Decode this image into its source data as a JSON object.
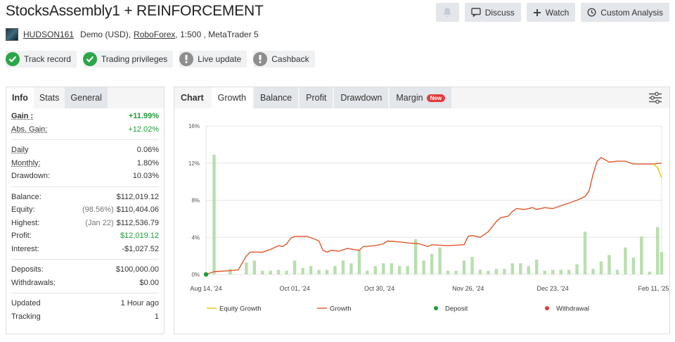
{
  "header": {
    "title": "StocksAssembly1 + REINFORCEMENT",
    "actions": {
      "discuss": "Discuss",
      "watch": "Watch",
      "custom": "Custom Analysis"
    }
  },
  "account": {
    "user": "HUDSON161",
    "type": "Demo (USD),",
    "broker": "RoboForex",
    "rest": ", 1:500 , MetaTrader 5"
  },
  "badges": [
    {
      "label": "Track record",
      "status": "ok"
    },
    {
      "label": "Trading privileges",
      "status": "ok"
    },
    {
      "label": "Live update",
      "status": "warn"
    },
    {
      "label": "Cashback",
      "status": "warn"
    }
  ],
  "info": {
    "tabs": [
      "Info",
      "Stats",
      "General"
    ],
    "gain_label": "Gain :",
    "gain": "+11.99%",
    "abs_gain_label": "Abs. Gain:",
    "abs_gain": "+12.02%",
    "daily_label": "Daily",
    "daily": "0.06%",
    "monthly_label": "Monthly:",
    "monthly": "1.80%",
    "drawdown_label": "Drawdown:",
    "drawdown": "10.03%",
    "balance_label": "Balance:",
    "balance": "$112,019.12",
    "equity_label": "Equity:",
    "equity_pct": "(98.56%)",
    "equity": "$110,404.06",
    "highest_label": "Highest:",
    "highest_date": "(Jan 22)",
    "highest": "$112,536.79",
    "profit_label": "Profit:",
    "profit": "$12,019.12",
    "interest_label": "Interest:",
    "interest": "-$1,027.52",
    "deposits_label": "Deposits:",
    "deposits": "$100,000.00",
    "withdrawals_label": "Withdrawals:",
    "withdrawals": "$0.00",
    "updated_label": "Updated",
    "updated": "1 Hour ago",
    "tracking_label": "Tracking",
    "tracking": "1"
  },
  "chart_tabs": {
    "label": "Chart",
    "items": [
      "Growth",
      "Balance",
      "Profit",
      "Drawdown",
      "Margin"
    ],
    "new_badge": "New"
  },
  "colors": {
    "growth": "#e2562a",
    "equity": "#e6c800",
    "bars": "#b8dfae",
    "deposit": "#1a9e36",
    "withdrawal": "#e33b3b"
  },
  "chart_data": {
    "type": "line",
    "ylim": [
      0,
      16
    ],
    "y_ticks": [
      "0%",
      "4%",
      "8%",
      "12%",
      "16%"
    ],
    "x_ticks": [
      "Aug 14, '24",
      "Oct 01, '24",
      "Oct 30, '24",
      "Nov 26, '24",
      "Dec 23, '24",
      "Feb 11, '25"
    ],
    "x_tick_index": [
      0,
      22,
      43,
      65,
      86,
      111
    ],
    "n_points": 114,
    "legend": [
      "Equity Growth",
      "Growth",
      "Deposit",
      "Withdrawal"
    ],
    "growth_knots": [
      [
        0,
        0.0
      ],
      [
        2,
        0.3
      ],
      [
        6,
        0.4
      ],
      [
        8,
        0.5
      ],
      [
        10,
        2.0
      ],
      [
        11,
        2.4
      ],
      [
        14,
        2.4
      ],
      [
        16,
        2.7
      ],
      [
        18,
        3.1
      ],
      [
        19,
        3.0
      ],
      [
        20,
        3.3
      ],
      [
        21,
        3.9
      ],
      [
        22,
        4.1
      ],
      [
        25,
        4.1
      ],
      [
        27,
        3.8
      ],
      [
        28,
        3.6
      ],
      [
        29,
        2.6
      ],
      [
        30,
        2.4
      ],
      [
        31,
        2.6
      ],
      [
        33,
        2.5
      ],
      [
        35,
        2.8
      ],
      [
        38,
        2.6
      ],
      [
        39,
        3.0
      ],
      [
        42,
        3.1
      ],
      [
        44,
        3.3
      ],
      [
        45,
        3.6
      ],
      [
        48,
        3.5
      ],
      [
        50,
        3.4
      ],
      [
        53,
        3.3
      ],
      [
        55,
        3.0
      ],
      [
        56,
        3.2
      ],
      [
        60,
        3.1
      ],
      [
        64,
        3.2
      ],
      [
        65,
        4.1
      ],
      [
        66,
        4.2
      ],
      [
        68,
        4.0
      ],
      [
        70,
        4.6
      ],
      [
        72,
        5.7
      ],
      [
        73,
        6.1
      ],
      [
        75,
        6.3
      ],
      [
        76,
        6.8
      ],
      [
        77,
        7.1
      ],
      [
        79,
        7.0
      ],
      [
        81,
        7.2
      ],
      [
        82,
        7.0
      ],
      [
        84,
        7.2
      ],
      [
        86,
        7.1
      ],
      [
        88,
        7.4
      ],
      [
        90,
        7.7
      ],
      [
        92,
        8.0
      ],
      [
        94,
        8.4
      ],
      [
        95,
        9.0
      ],
      [
        96,
        10.8
      ],
      [
        97,
        12.2
      ],
      [
        98,
        12.6
      ],
      [
        100,
        12.1
      ],
      [
        102,
        12.2
      ],
      [
        104,
        12.2
      ],
      [
        106,
        11.9
      ],
      [
        108,
        11.9
      ],
      [
        111,
        11.9
      ],
      [
        113,
        12.0
      ]
    ],
    "equity_knots": [
      [
        111,
        11.9
      ],
      [
        112,
        11.5
      ],
      [
        113,
        10.4
      ]
    ],
    "bar_values": [
      [
        2,
        12.9
      ],
      [
        6,
        0.6
      ],
      [
        10,
        1.3
      ],
      [
        12,
        1.5
      ],
      [
        14,
        0.4
      ],
      [
        16,
        0.4
      ],
      [
        18,
        0.5
      ],
      [
        20,
        0.4
      ],
      [
        22,
        1.5
      ],
      [
        24,
        0.7
      ],
      [
        26,
        0.9
      ],
      [
        28,
        0.5
      ],
      [
        30,
        0.5
      ],
      [
        32,
        0.9
      ],
      [
        34,
        1.5
      ],
      [
        36,
        1.2
      ],
      [
        38,
        2.6
      ],
      [
        40,
        0.4
      ],
      [
        42,
        0.9
      ],
      [
        44,
        1.2
      ],
      [
        46,
        1.2
      ],
      [
        48,
        0.9
      ],
      [
        50,
        0.9
      ],
      [
        52,
        3.8
      ],
      [
        54,
        1.5
      ],
      [
        56,
        2.2
      ],
      [
        58,
        2.9
      ],
      [
        60,
        0.4
      ],
      [
        62,
        0.4
      ],
      [
        64,
        1.5
      ],
      [
        66,
        1.9
      ],
      [
        68,
        0.5
      ],
      [
        70,
        0.4
      ],
      [
        72,
        0.6
      ],
      [
        74,
        0.6
      ],
      [
        76,
        1.2
      ],
      [
        78,
        1.2
      ],
      [
        80,
        0.9
      ],
      [
        82,
        1.6
      ],
      [
        84,
        0.4
      ],
      [
        86,
        0.5
      ],
      [
        88,
        0.5
      ],
      [
        90,
        0.5
      ],
      [
        92,
        1.1
      ],
      [
        94,
        4.6
      ],
      [
        96,
        0.6
      ],
      [
        98,
        1.4
      ],
      [
        100,
        2.1
      ],
      [
        102,
        0.5
      ],
      [
        104,
        2.9
      ],
      [
        106,
        1.8
      ],
      [
        108,
        4.1
      ],
      [
        110,
        0.3
      ],
      [
        112,
        5.1
      ],
      [
        113,
        2.4
      ]
    ],
    "deposit_points": [
      [
        0,
        0.0
      ]
    ]
  }
}
